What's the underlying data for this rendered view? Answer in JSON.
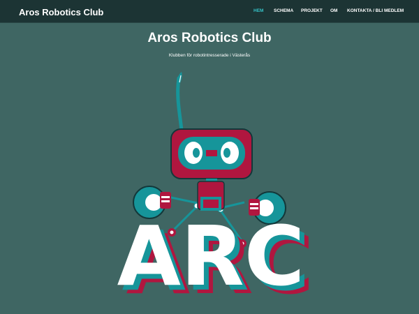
{
  "header": {
    "brand": "Aros Robotics Club",
    "nav": [
      {
        "label": "HEM",
        "active": true
      },
      {
        "label": "SCHEMA",
        "active": false
      },
      {
        "label": "PROJEKT",
        "active": false
      },
      {
        "label": "OM",
        "active": false
      },
      {
        "label": "KONTAKTA / BLI MEDLEM",
        "active": false
      }
    ]
  },
  "hero": {
    "title": "Aros Robotics Club",
    "subtitle": "Klubben för robotintresserade i Västerås"
  },
  "logo": {
    "text": "ARC",
    "colors": {
      "background": "#3f6663",
      "topbar": "#1c3434",
      "teal": "#16959a",
      "crimson": "#b0163f",
      "white": "#ffffff",
      "nav_active": "#35c2c7"
    }
  }
}
